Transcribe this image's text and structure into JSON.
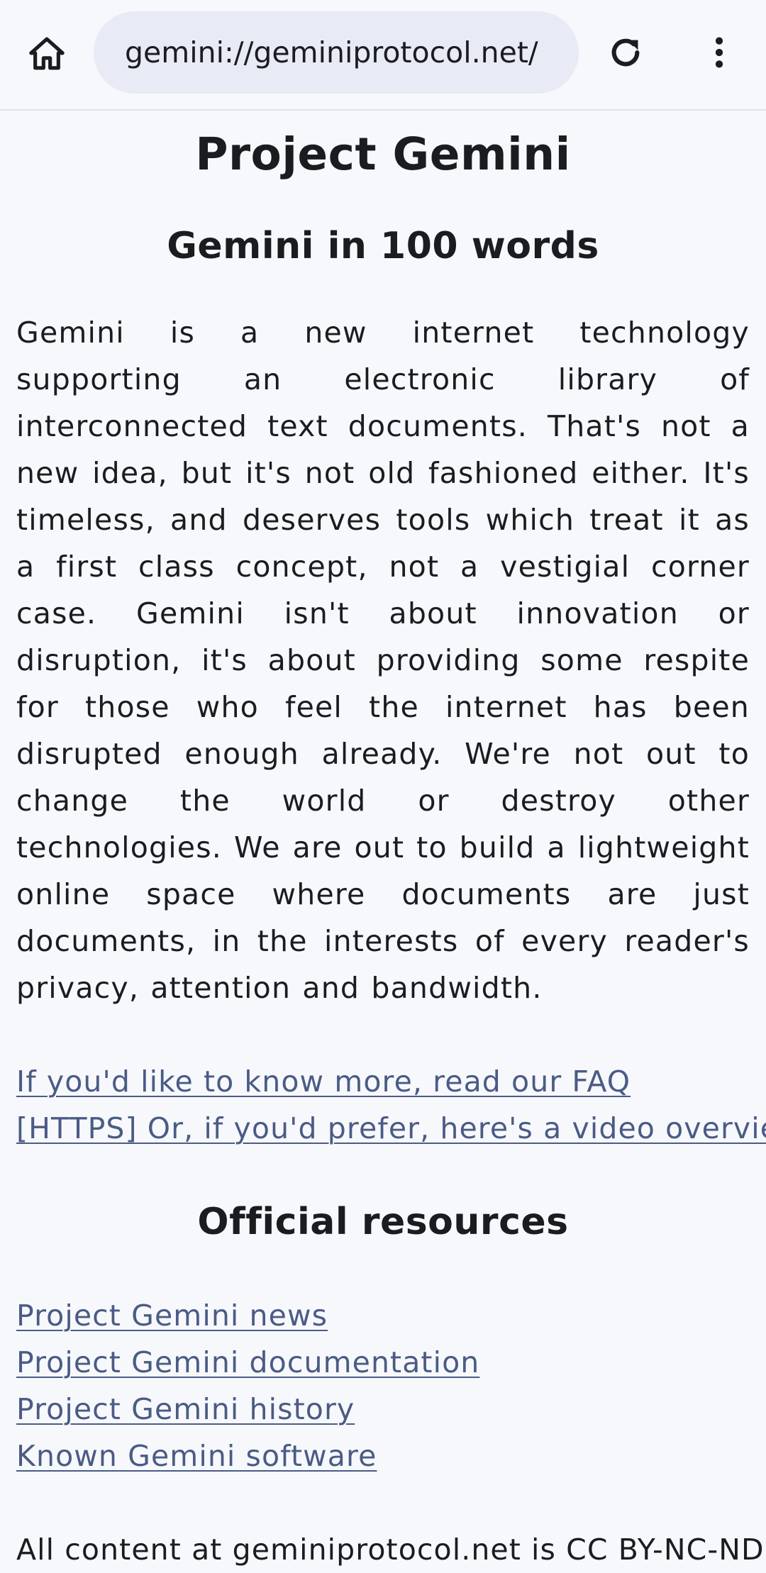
{
  "toolbar": {
    "home_icon": "home-icon",
    "url": "gemini://geminiprotocol.net/",
    "reload_icon": "reload-icon",
    "menu_icon": "more-vert-icon"
  },
  "page": {
    "title": "Project Gemini",
    "section1_heading": "Gemini in 100 words",
    "intro_paragraph": "Gemini is a new internet technology supporting an electronic library of interconnected text documents.  That's not a new idea, but it's not old fashioned either.  It's timeless, and deserves tools which treat it as a first class concept, not a vestigial corner case.  Gemini isn't about innovation or disruption, it's about providing some respite for those who feel the internet has been disrupted enough already.  We're not out to change the world or destroy other technologies.  We are out to build a lightweight online space where documents are just documents, in the interests of every reader's privacy, attention and bandwidth.",
    "faq_link": "If you'd like to know more, read our FAQ",
    "video_link": "[HTTPS] Or, if you'd prefer, here's a video overview",
    "section2_heading": "Official resources",
    "resources": [
      "Project Gemini news",
      "Project Gemini documentation",
      "Project Gemini history",
      "Known Gemini software"
    ],
    "footer_text": "All content at geminiprotocol.net is CC BY-NC-ND"
  },
  "colors": {
    "background": "#f7f8fc",
    "url_pill": "#e8ebf6",
    "link": "#4a5b85",
    "text": "#1b1c20"
  }
}
